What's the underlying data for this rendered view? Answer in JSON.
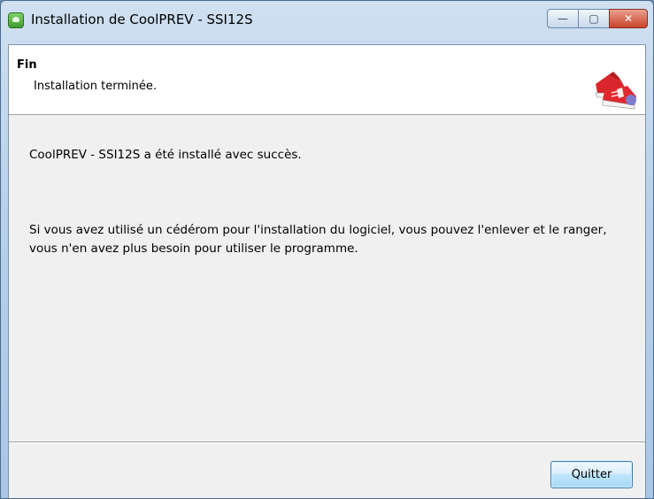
{
  "window": {
    "title": "Installation de CoolPREV - SSI12S",
    "controls": {
      "minimize": "—",
      "maximize": "▢",
      "close": "✕"
    }
  },
  "header": {
    "title": "Fin",
    "subtitle": "Installation terminée."
  },
  "content": {
    "line1": "CoolPREV - SSI12S a été installé avec succès.",
    "line2": "Si vous avez utilisé un cédérom pour l'installation du logiciel, vous pouvez l'enlever et le ranger, vous n'en avez plus besoin pour utiliser le programme."
  },
  "footer": {
    "quit_label": "Quitter"
  }
}
